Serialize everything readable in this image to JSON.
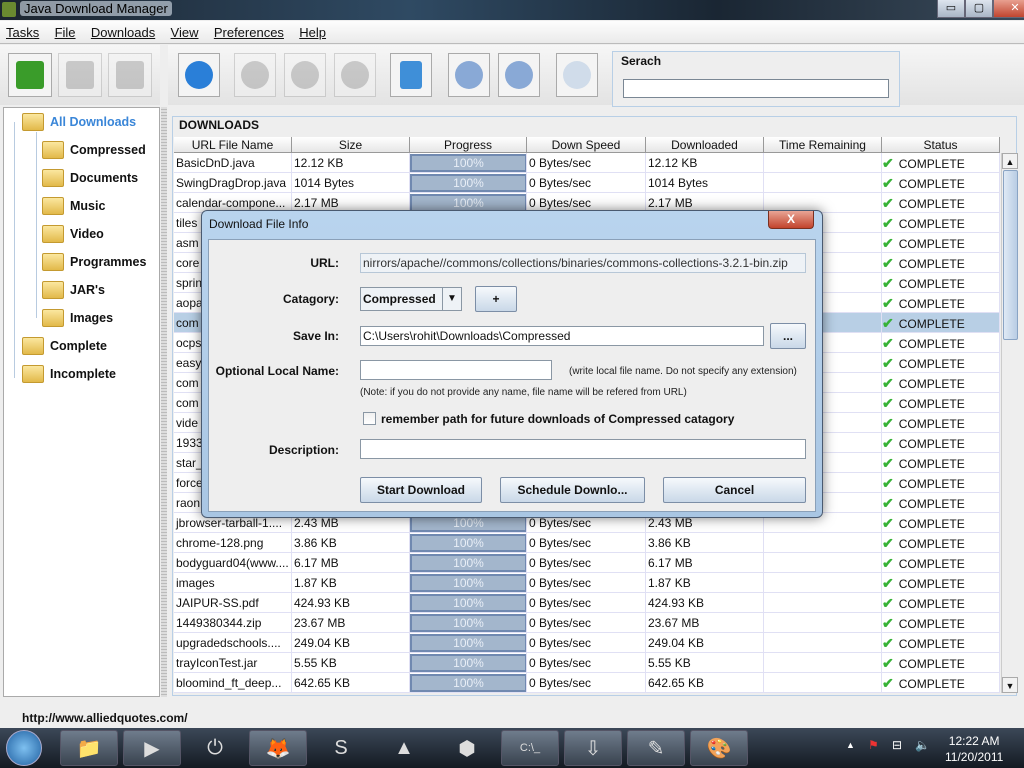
{
  "window": {
    "title": "Java Download Manager",
    "min": "▭",
    "max": "▢",
    "close": "✕"
  },
  "menu": [
    "Tasks",
    "File",
    "Downloads",
    "View",
    "Preferences",
    "Help"
  ],
  "toolbar_left": [
    {
      "name": "new-category-icon",
      "color": "#3a9c2a",
      "disabled": false
    },
    {
      "name": "edit-category-icon",
      "color": "#999",
      "disabled": true
    },
    {
      "name": "delete-category-icon",
      "color": "#999",
      "disabled": true
    }
  ],
  "toolbar_main": [
    {
      "name": "add-download-icon",
      "color": "#2a7fd8",
      "disabled": false
    },
    {
      "name": "pause-icon",
      "color": "#999",
      "disabled": true
    },
    {
      "name": "resume-icon",
      "color": "#999",
      "disabled": true
    },
    {
      "name": "cancel-icon",
      "color": "#999",
      "disabled": true
    },
    {
      "name": "trash-icon",
      "color": "#3f8fd8",
      "disabled": false
    },
    {
      "name": "move-up-icon",
      "color": "#89a9d6",
      "disabled": false
    },
    {
      "name": "move-down-icon",
      "color": "#89a9d6",
      "disabled": false
    },
    {
      "name": "schedule-clock-icon",
      "color": "#d0dcea",
      "disabled": false
    }
  ],
  "search": {
    "label": "Serach",
    "value": ""
  },
  "tree": {
    "root": "All Downloads",
    "children": [
      "Compressed",
      "Documents",
      "Music",
      "Video",
      "Programmes",
      "JAR's",
      "Images"
    ],
    "others": [
      "Complete",
      "Incomplete"
    ]
  },
  "downloads": {
    "title": "DOWNLOADS",
    "columns": [
      "URL File Name",
      "Size",
      "Progress",
      "Down Speed",
      "Downloaded",
      "Time Remaining",
      "Status"
    ],
    "rows": [
      {
        "name": "BasicDnD.java",
        "size": "12.12 KB",
        "progress": "100%",
        "speed": "0 Bytes/sec",
        "downloaded": "12.12 KB",
        "remaining": "",
        "status": "COMPLETE"
      },
      {
        "name": "SwingDragDrop.java",
        "size": "1014 Bytes",
        "progress": "100%",
        "speed": "0 Bytes/sec",
        "downloaded": "1014 Bytes",
        "remaining": "",
        "status": "COMPLETE"
      },
      {
        "name": "calendar-compone...",
        "size": "2.17 MB",
        "progress": "100%",
        "speed": "0 Bytes/sec",
        "downloaded": "2.17 MB",
        "remaining": "",
        "status": "COMPLETE"
      },
      {
        "name": "tiles",
        "size": "",
        "progress": "",
        "speed": "",
        "downloaded": "",
        "remaining": "",
        "status": "COMPLETE"
      },
      {
        "name": "asm",
        "size": "",
        "progress": "",
        "speed": "",
        "downloaded": "",
        "remaining": "",
        "status": "COMPLETE"
      },
      {
        "name": "core",
        "size": "",
        "progress": "",
        "speed": "",
        "downloaded": "",
        "remaining": "",
        "status": "COMPLETE"
      },
      {
        "name": "sprin",
        "size": "",
        "progress": "",
        "speed": "",
        "downloaded": "",
        "remaining": "",
        "status": "COMPLETE"
      },
      {
        "name": "aopa",
        "size": "",
        "progress": "",
        "speed": "",
        "downloaded": "",
        "remaining": "",
        "status": "COMPLETE"
      },
      {
        "name": "com",
        "size": "",
        "progress": "",
        "speed": "",
        "downloaded": "",
        "remaining": "",
        "status": "COMPLETE",
        "selected": true
      },
      {
        "name": "ocps",
        "size": "",
        "progress": "",
        "speed": "",
        "downloaded": "",
        "remaining": "",
        "status": "COMPLETE"
      },
      {
        "name": "easy",
        "size": "",
        "progress": "",
        "speed": "",
        "downloaded": "",
        "remaining": "",
        "status": "COMPLETE"
      },
      {
        "name": "com",
        "size": "",
        "progress": "",
        "speed": "",
        "downloaded": "",
        "remaining": "",
        "status": "COMPLETE"
      },
      {
        "name": "com",
        "size": "",
        "progress": "",
        "speed": "",
        "downloaded": "",
        "remaining": "",
        "status": "COMPLETE"
      },
      {
        "name": "vide",
        "size": "",
        "progress": "",
        "speed": "",
        "downloaded": "",
        "remaining": "",
        "status": "COMPLETE"
      },
      {
        "name": "1933",
        "size": "",
        "progress": "",
        "speed": "",
        "downloaded": "",
        "remaining": "",
        "status": "COMPLETE"
      },
      {
        "name": "star_",
        "size": "",
        "progress": "",
        "speed": "",
        "downloaded": "",
        "remaining": "",
        "status": "COMPLETE"
      },
      {
        "name": "force",
        "size": "",
        "progress": "",
        "speed": "",
        "downloaded": "",
        "remaining": "",
        "status": "COMPLETE"
      },
      {
        "name": "raon",
        "size": "",
        "progress": "",
        "speed": "",
        "downloaded": "",
        "remaining": "",
        "status": "COMPLETE"
      },
      {
        "name": "jbrowser-tarball-1....",
        "size": "2.43 MB",
        "progress": "100%",
        "speed": "0 Bytes/sec",
        "downloaded": "2.43 MB",
        "remaining": "",
        "status": "COMPLETE"
      },
      {
        "name": "chrome-128.png",
        "size": "3.86 KB",
        "progress": "100%",
        "speed": "0 Bytes/sec",
        "downloaded": "3.86 KB",
        "remaining": "",
        "status": "COMPLETE"
      },
      {
        "name": "bodyguard04(www....",
        "size": "6.17 MB",
        "progress": "100%",
        "speed": "0 Bytes/sec",
        "downloaded": "6.17 MB",
        "remaining": "",
        "status": "COMPLETE"
      },
      {
        "name": "images",
        "size": "1.87 KB",
        "progress": "100%",
        "speed": "0 Bytes/sec",
        "downloaded": "1.87 KB",
        "remaining": "",
        "status": "COMPLETE"
      },
      {
        "name": "JAIPUR-SS.pdf",
        "size": "424.93 KB",
        "progress": "100%",
        "speed": "0 Bytes/sec",
        "downloaded": "424.93 KB",
        "remaining": "",
        "status": "COMPLETE"
      },
      {
        "name": "1449380344.zip",
        "size": "23.67 MB",
        "progress": "100%",
        "speed": "0 Bytes/sec",
        "downloaded": "23.67 MB",
        "remaining": "",
        "status": "COMPLETE"
      },
      {
        "name": "upgradedschools....",
        "size": "249.04 KB",
        "progress": "100%",
        "speed": "0 Bytes/sec",
        "downloaded": "249.04 KB",
        "remaining": "",
        "status": "COMPLETE"
      },
      {
        "name": "trayIconTest.jar",
        "size": "5.55 KB",
        "progress": "100%",
        "speed": "0 Bytes/sec",
        "downloaded": "5.55 KB",
        "remaining": "",
        "status": "COMPLETE"
      },
      {
        "name": "bloomind_ft_deep...",
        "size": "642.65 KB",
        "progress": "100%",
        "speed": "0 Bytes/sec",
        "downloaded": "642.65 KB",
        "remaining": "",
        "status": "COMPLETE"
      }
    ]
  },
  "dialog": {
    "title": "Download File Info",
    "close": "X",
    "url_label": "URL:",
    "url": "nirrors/apache//commons/collections/binaries/commons-collections-3.2.1-bin.zip",
    "category_label": "Catagory:",
    "category": "Compressed",
    "add": "+",
    "savein_label": "Save In:",
    "savein": "C:\\Users\\rohit\\Downloads\\Compressed",
    "browse": "...",
    "localname_label": "Optional Local Name:",
    "localname": "",
    "localname_hint": "(write local file name. Do not specify any extension)",
    "note": "(Note: if you do not provide any name, file name will be refered from URL)",
    "remember": "remember path for future downloads of Compressed catagory",
    "remember_checked": false,
    "description_label": "Description:",
    "description": "",
    "start": "Start Download",
    "schedule": "Schedule Downlo...",
    "cancel": "Cancel"
  },
  "statusbar": "http://www.alliedquotes.com/",
  "taskbar": {
    "apps": [
      {
        "name": "explorer-icon",
        "glyph": "📁",
        "open": true
      },
      {
        "name": "media-player-icon",
        "glyph": "▶",
        "open": true
      },
      {
        "name": "power-app-icon",
        "glyph": "⏻",
        "open": false
      },
      {
        "name": "firefox-icon",
        "glyph": "🦊",
        "open": true
      },
      {
        "name": "skype-icon",
        "glyph": "S",
        "open": false
      },
      {
        "name": "vlc-icon",
        "glyph": "▲",
        "open": false
      },
      {
        "name": "virtualbox-icon",
        "glyph": "⬢",
        "open": false
      },
      {
        "name": "cmd-icon",
        "glyph": "C:\\_",
        "open": true
      },
      {
        "name": "download-manager-icon",
        "glyph": "⇩",
        "open": true
      },
      {
        "name": "notepad-icon",
        "glyph": "✎",
        "open": true
      },
      {
        "name": "paint-icon",
        "glyph": "🎨",
        "open": true
      }
    ],
    "time": "12:22 AM",
    "date": "11/20/2011"
  }
}
